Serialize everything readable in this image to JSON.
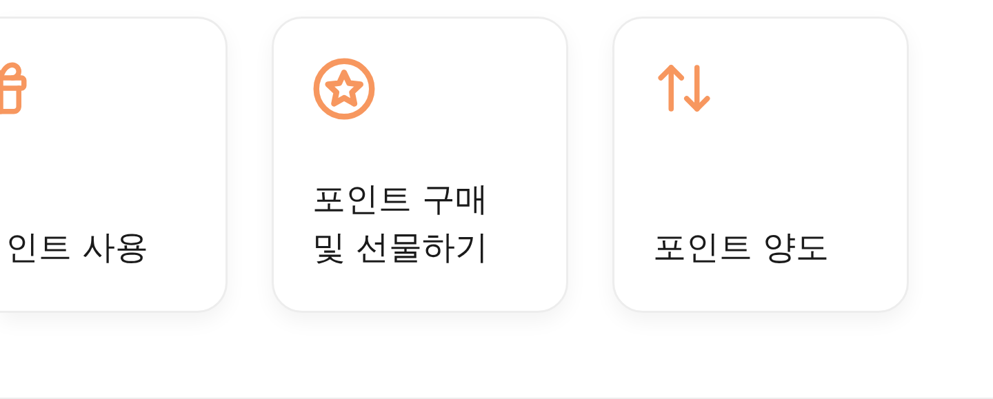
{
  "cards": [
    {
      "kind": "gift",
      "title": "인트 사용"
    },
    {
      "kind": "star",
      "title": "포인트 구매\n및 선물하기"
    },
    {
      "kind": "transfer",
      "title": "포인트 양도"
    }
  ]
}
